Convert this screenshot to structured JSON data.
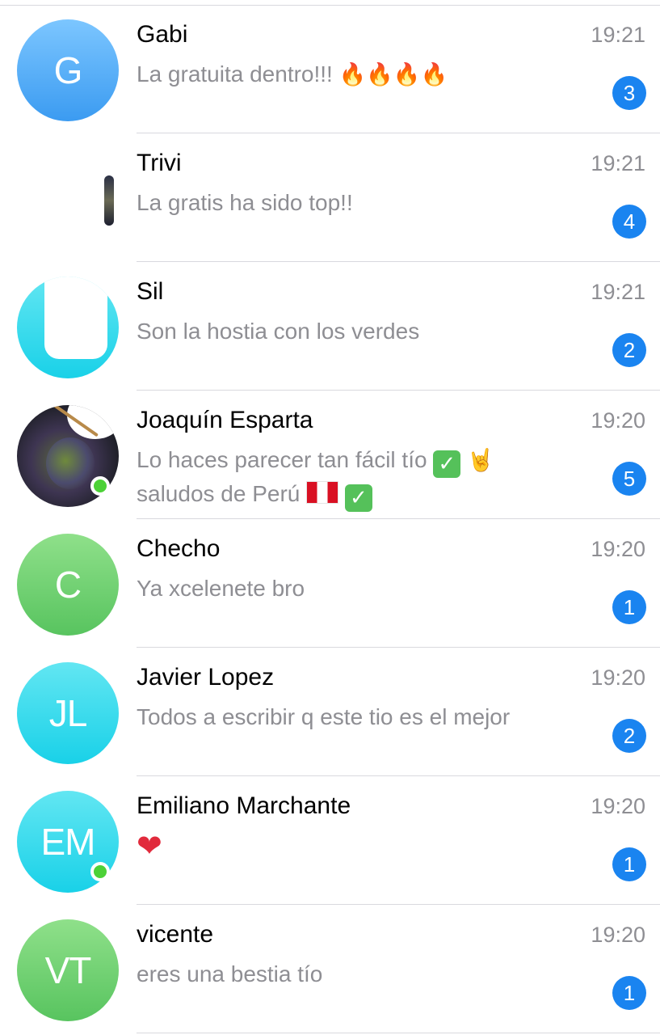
{
  "chats": [
    {
      "name": "Gabi",
      "time": "19:21",
      "preview": "La gratuita dentro!!!",
      "preview_emojis": [
        "fire",
        "fire",
        "fire",
        "fire"
      ],
      "unread": "3",
      "avatar": {
        "initials": "G",
        "color": "#4aa8f5"
      }
    },
    {
      "name": "Trivi",
      "time": "19:21",
      "preview": "La gratis ha sido top!!",
      "unread": "4",
      "avatar": {
        "initials": "",
        "color": "#ffffff"
      }
    },
    {
      "name": "Sil",
      "time": "19:21",
      "preview": "Son la hostia con los verdes",
      "unread": "2",
      "avatar": {
        "initials": "",
        "color": "#1fd3e8"
      }
    },
    {
      "name": "Joaquín Esparta",
      "time": "19:20",
      "preview_line1": "Lo haces parecer tan fácil tío",
      "preview_line1_emojis": [
        "check-mark-button",
        "sign-of-the-horns"
      ],
      "preview_line2": "saludos de Perú",
      "preview_line2_emojis": [
        "flag-peru",
        "check-mark-button"
      ],
      "unread": "5",
      "online": true
    },
    {
      "name": "Checho",
      "time": "19:20",
      "preview": "Ya xcelenete bro",
      "unread": "1",
      "avatar": {
        "initials": "C",
        "color": "#62c764"
      }
    },
    {
      "name": "Javier Lopez",
      "time": "19:20",
      "preview": "Todos a escribir q este tio es el mejor",
      "unread": "2",
      "avatar": {
        "initials": "JL",
        "color": "#1fd3e8"
      }
    },
    {
      "name": "Emiliano Marchante",
      "time": "19:20",
      "preview_emojis": [
        "red-heart"
      ],
      "unread": "1",
      "online": true,
      "avatar": {
        "initials": "EM",
        "color": "#1fd3e8"
      }
    },
    {
      "name": "vicente",
      "time": "19:20",
      "preview": "eres una bestia tío",
      "unread": "1",
      "avatar": {
        "initials": "VT",
        "color": "#62c764"
      }
    }
  ],
  "colors": {
    "badge": "#1a84f0",
    "online": "#4cd137",
    "secondary_text": "#8e8e93",
    "divider": "#d9d9de"
  }
}
